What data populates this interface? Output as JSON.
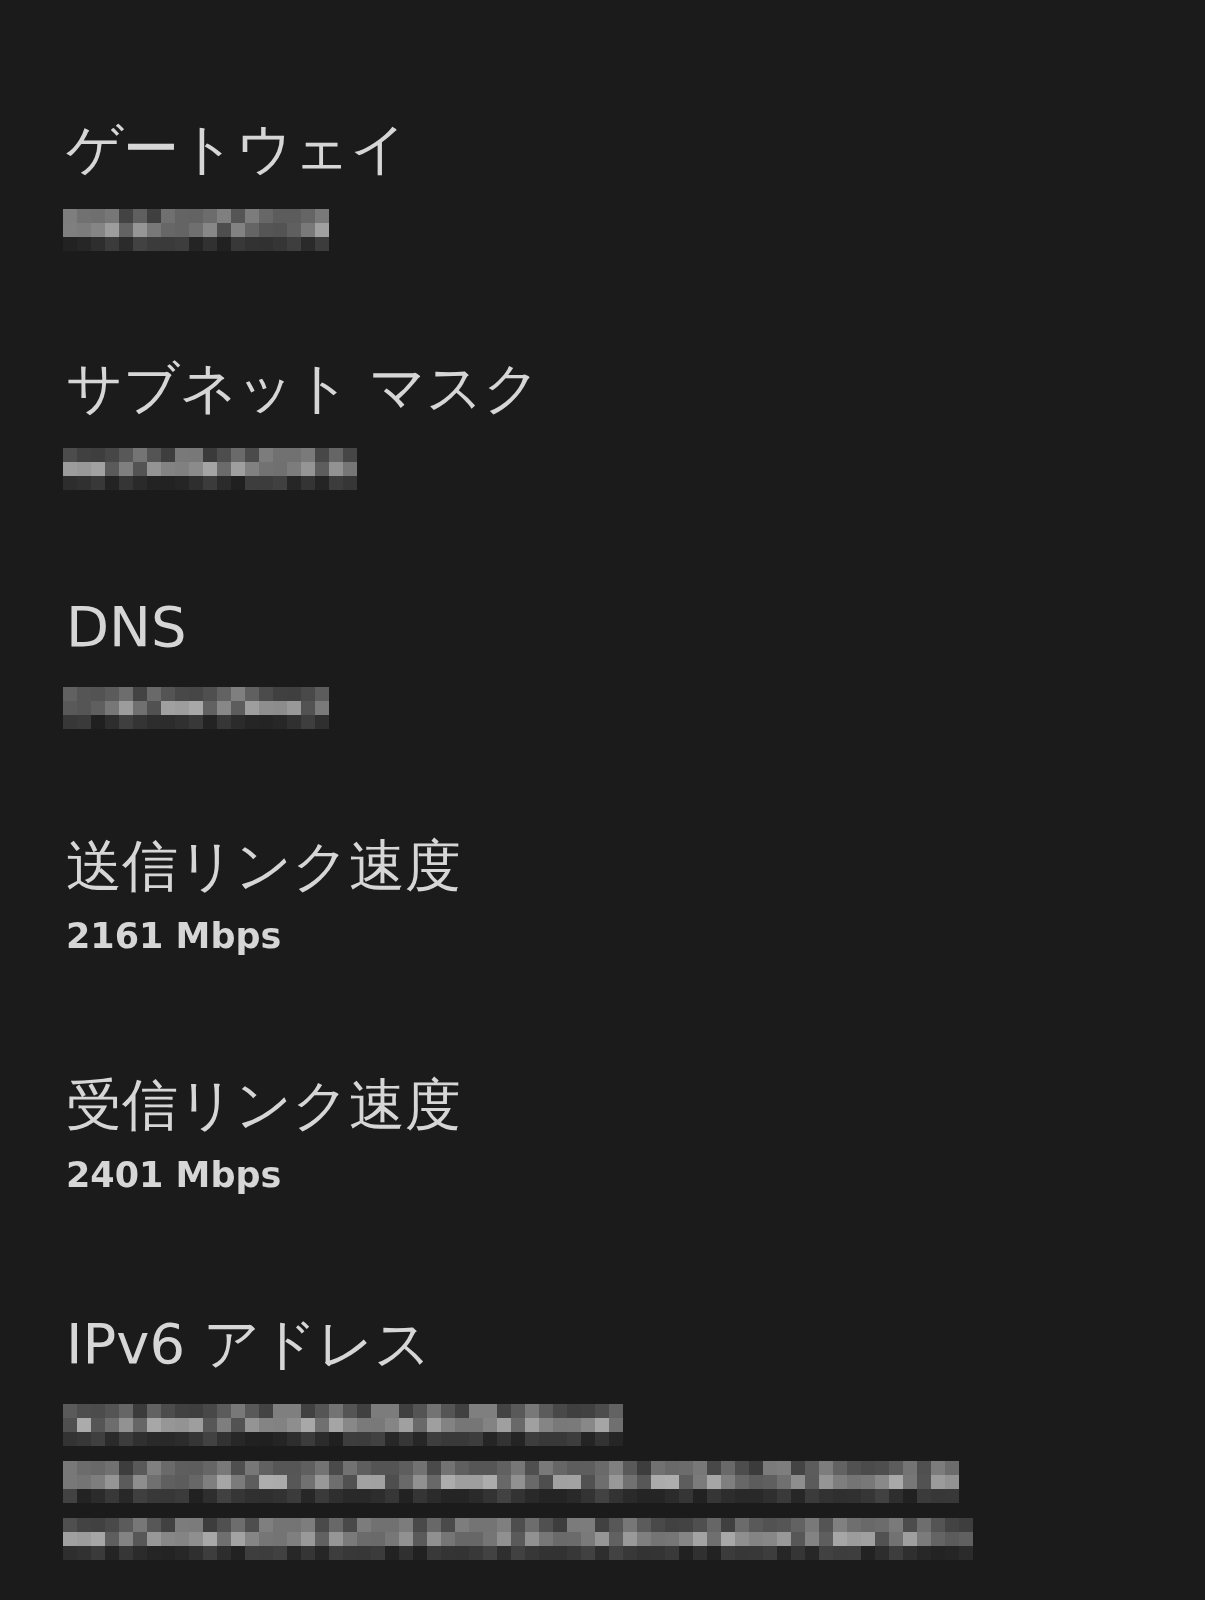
{
  "items": [
    {
      "label": "ゲートウェイ",
      "value": {
        "kind": "redacted",
        "lines": [
          {
            "kind": "short"
          }
        ]
      }
    },
    {
      "label": "サブネット マスク",
      "value": {
        "kind": "redacted",
        "lines": [
          {
            "kind": "medium"
          }
        ]
      }
    },
    {
      "label": "DNS",
      "value": {
        "kind": "redacted",
        "lines": [
          {
            "kind": "short"
          }
        ]
      }
    },
    {
      "label": "送信リンク速度",
      "value": {
        "kind": "text",
        "text": "2161 Mbps"
      }
    },
    {
      "label": "受信リンク速度",
      "value": {
        "kind": "text",
        "text": "2401 Mbps"
      }
    },
    {
      "label": "IPv6 アドレス",
      "value": {
        "kind": "redacted",
        "lines": [
          {
            "kind": "long"
          },
          {
            "kind": "wide"
          },
          {
            "kind": "widest"
          }
        ]
      }
    }
  ]
}
